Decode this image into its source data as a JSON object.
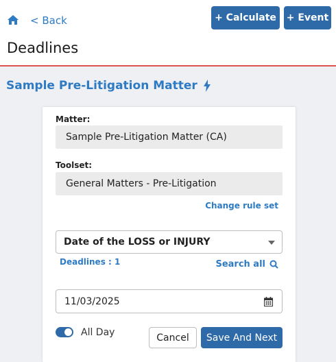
{
  "header": {
    "back_label": "< Back",
    "calculate_label": "+ Calculate",
    "event_label": "+ Event",
    "page_title": "Deadlines"
  },
  "matter_title": "Sample Pre-Litigation Matter",
  "form": {
    "matter_label": "Matter:",
    "matter_value": "Sample Pre-Litigation Matter (CA)",
    "toolset_label": "Toolset:",
    "toolset_value": "General Matters - Pre-Litigation",
    "change_rule_set": "Change rule set",
    "trigger_selected": "Date of the LOSS or INJURY",
    "deadlines_count": "Deadlines : 1",
    "search_all": "Search all",
    "date_value": "11/03/2025",
    "all_day_label": "All Day",
    "all_day_checked": true,
    "cancel_label": "Cancel",
    "save_next_label": "Save And Next"
  },
  "icons": {
    "home": "home-icon",
    "bolt": "lightning-bolt-icon",
    "search": "search-icon",
    "calendar": "calendar-icon",
    "dropdown": "chevron-down-icon"
  },
  "colors": {
    "accent": "#2e7bc4",
    "primary_button": "#2e6aa8",
    "divider": "#d9534f",
    "background": "#eef0f4"
  }
}
